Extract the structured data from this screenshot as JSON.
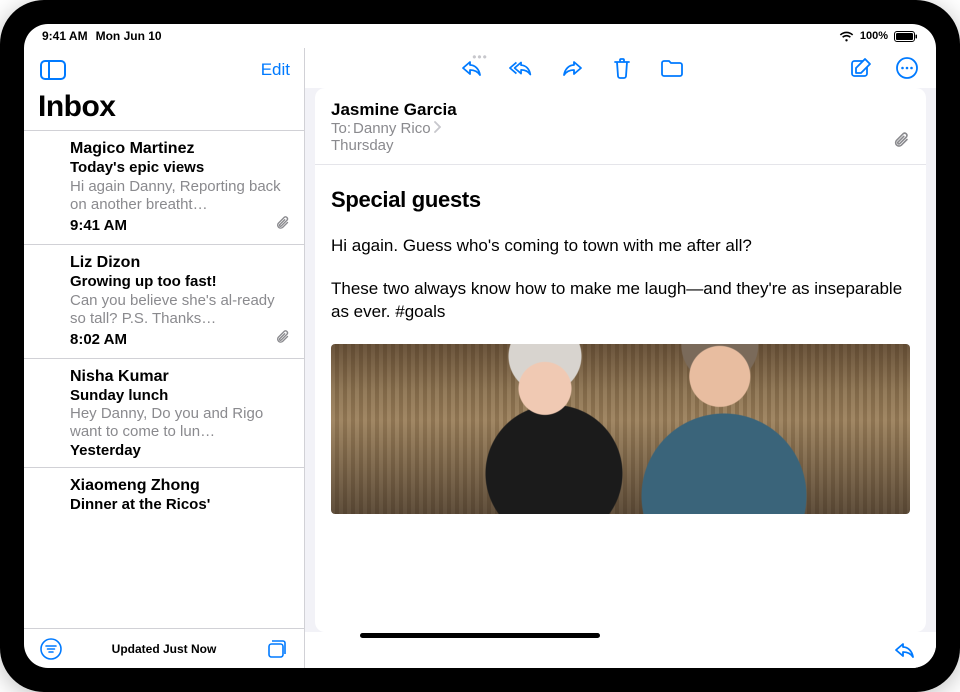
{
  "status": {
    "time": "9:41 AM",
    "date": "Mon Jun 10",
    "battery": "100%"
  },
  "sidebar": {
    "edit_label": "Edit",
    "title": "Inbox",
    "status": "Updated Just Now",
    "items": [
      {
        "sender": "Magico Martinez",
        "subject": "Today's epic views",
        "preview": "Hi again Danny, Reporting back on another breatht…",
        "time": "9:41 AM",
        "has_attachment": true
      },
      {
        "sender": "Liz Dizon",
        "subject": "Growing up too fast!",
        "preview": "Can you believe she's al-ready so tall? P.S. Thanks…",
        "time": "8:02 AM",
        "has_attachment": true
      },
      {
        "sender": "Nisha Kumar",
        "subject": "Sunday lunch",
        "preview": "Hey Danny, Do you and Rigo want to come to lun…",
        "time": "Yesterday",
        "has_attachment": false
      },
      {
        "sender": "Xiaomeng Zhong",
        "subject": "Dinner at the Ricos'",
        "preview": "",
        "time": "",
        "has_attachment": false
      }
    ]
  },
  "message": {
    "sender": "Jasmine Garcia",
    "to_label": "To:",
    "to_name": "Danny Rico",
    "date": "Thursday",
    "subject": "Special guests",
    "paragraphs": [
      "Hi again. Guess who's coming to town with me after all?",
      "These two always know how to make me laugh—and they're as inseparable as ever. #goals"
    ]
  }
}
